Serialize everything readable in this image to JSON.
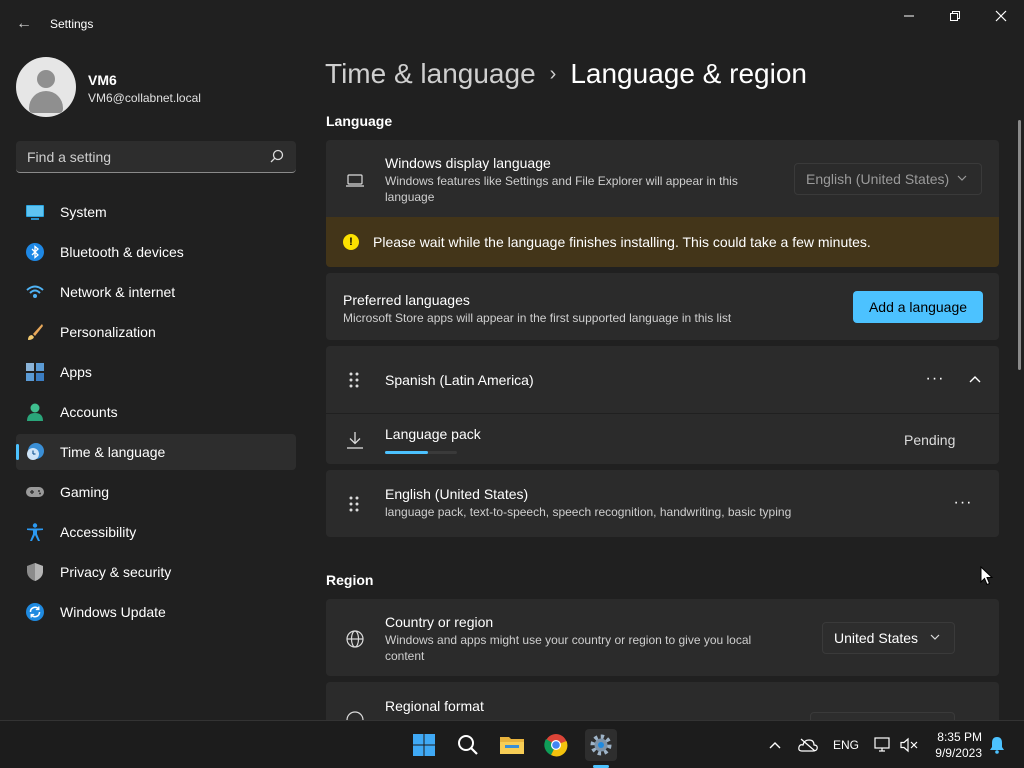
{
  "window": {
    "title": "Settings",
    "back_glyph": "←",
    "minimize_glyph": "—",
    "maximize_glyph": "❐",
    "close_glyph": "✕"
  },
  "profile": {
    "name": "VM6",
    "email": "VM6@collabnet.local"
  },
  "search": {
    "placeholder": "Find a setting",
    "value": ""
  },
  "sidebar": {
    "items": [
      {
        "label": "System",
        "icon": "system-icon",
        "active": false
      },
      {
        "label": "Bluetooth & devices",
        "icon": "bluetooth-icon",
        "active": false
      },
      {
        "label": "Network & internet",
        "icon": "wifi-icon",
        "active": false
      },
      {
        "label": "Personalization",
        "icon": "brush-icon",
        "active": false
      },
      {
        "label": "Apps",
        "icon": "apps-icon",
        "active": false
      },
      {
        "label": "Accounts",
        "icon": "accounts-icon",
        "active": false
      },
      {
        "label": "Time & language",
        "icon": "time-language-icon",
        "active": true
      },
      {
        "label": "Gaming",
        "icon": "gamepad-icon",
        "active": false
      },
      {
        "label": "Accessibility",
        "icon": "accessibility-icon",
        "active": false
      },
      {
        "label": "Privacy & security",
        "icon": "shield-icon",
        "active": false
      },
      {
        "label": "Windows Update",
        "icon": "update-icon",
        "active": false
      }
    ]
  },
  "breadcrumb": {
    "parent": "Time & language",
    "separator": "›",
    "current": "Language & region"
  },
  "language_section": {
    "title": "Language",
    "display_language": {
      "title": "Windows display language",
      "description": "Windows features like Settings and File Explorer will appear in this language",
      "selected": "English (United States)"
    },
    "warning": {
      "text": "Please wait while the language finishes installing. This could take a few minutes."
    },
    "preferred": {
      "title": "Preferred languages",
      "description": "Microsoft Store apps will appear in the first supported language in this list",
      "add_button": "Add a language"
    },
    "languages": [
      {
        "name": "Spanish (Latin America)",
        "details": "",
        "expanded": true
      },
      {
        "name": "English (United States)",
        "details": "language pack, text-to-speech, speech recognition, handwriting, basic typing",
        "expanded": false
      }
    ],
    "language_pack": {
      "title": "Language pack",
      "status": "Pending",
      "progress": 0.6
    },
    "more_glyph": "···",
    "collapse_glyph": "⌃"
  },
  "region_section": {
    "title": "Region",
    "country": {
      "title": "Country or region",
      "description": "Windows and apps might use your country or region to give you local content",
      "selected": "United States"
    },
    "format": {
      "title": "Regional format"
    }
  },
  "taskbar": {
    "apps": [
      "windows-start-icon",
      "search-icon",
      "file-explorer-icon",
      "chrome-icon",
      "settings-icon"
    ],
    "tray": {
      "chevron": "⌃",
      "language": "ENG"
    },
    "time": "8:35 PM",
    "date": "9/9/2023"
  },
  "colors": {
    "accent": "#4cc2ff",
    "background": "#202020",
    "card": "#2b2b2b",
    "warning_bg": "#433519",
    "warning_icon": "#fce100"
  }
}
